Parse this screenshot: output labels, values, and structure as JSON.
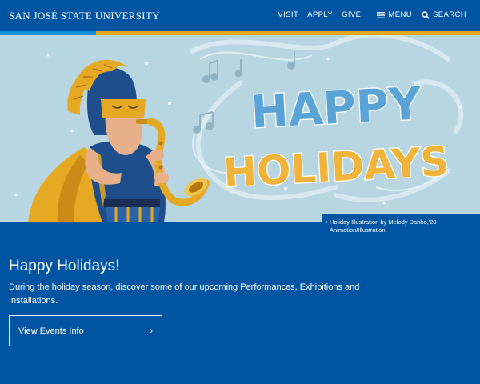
{
  "header": {
    "brand": "SAN JOSÉ STATE UNIVERSITY",
    "nav": [
      {
        "label": "VISIT"
      },
      {
        "label": "APPLY"
      },
      {
        "label": "GIVE"
      }
    ],
    "menu_label": "MENU",
    "search_label": "SEARCH"
  },
  "hero": {
    "art_title_line1": "HAPPY",
    "art_title_line2": "HOLIDAYS",
    "caption_line1": "Holiday Illustration by Melody Dahho,'28",
    "caption_line2": "Animation/Illustration"
  },
  "main": {
    "heading": "Happy Holidays!",
    "description": "During the holiday season, discover some of our upcoming Performances, Exhibitions and Installations.",
    "cta_label": "View Events Info",
    "cta_chevron": "›"
  },
  "colors": {
    "brand_blue": "#0055A2",
    "gold": "#E5A823",
    "sky": "#B3D3E0"
  }
}
